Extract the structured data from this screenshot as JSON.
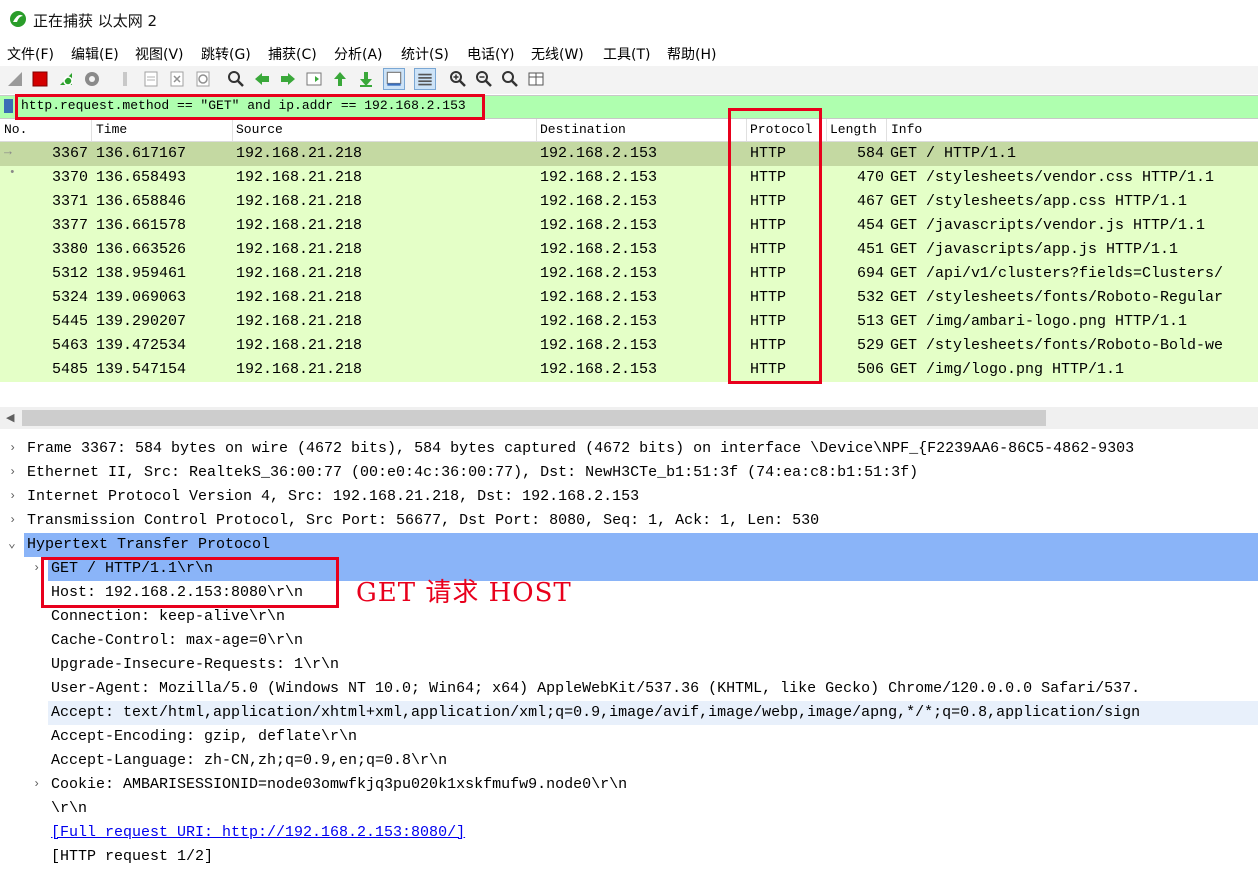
{
  "window": {
    "title": "正在捕获 以太网 2"
  },
  "menu": [
    "文件(F)",
    "编辑(E)",
    "视图(V)",
    "跳转(G)",
    "捕获(C)",
    "分析(A)",
    "统计(S)",
    "电话(Y)",
    "无线(W)",
    "工具(T)",
    "帮助(H)"
  ],
  "toolbar": {
    "icons": [
      "shark-fin-start-icon",
      "stop-capture-icon",
      "restart-capture-icon",
      "capture-options-icon",
      "open-file-icon",
      "save-file-icon",
      "close-file-icon",
      "reload-file-icon",
      "find-packet-icon",
      "go-back-icon",
      "go-forward-icon",
      "go-to-packet-icon",
      "first-packet-icon",
      "last-packet-icon",
      "auto-scroll-icon",
      "colorize-icon",
      "zoom-in-icon",
      "zoom-out-icon",
      "normal-size-icon",
      "resize-columns-icon"
    ]
  },
  "filter": {
    "expression": "http.request.method == \"GET\" and ip.addr == 192.168.2.153"
  },
  "packet_list": {
    "columns": [
      "No.",
      "Time",
      "Source",
      "Destination",
      "Protocol",
      "Length",
      "Info"
    ],
    "rows": [
      {
        "no": "3367",
        "time": "136.617167",
        "src": "192.168.21.218",
        "dst": "192.168.2.153",
        "proto": "HTTP",
        "len": "584",
        "info": "GET / HTTP/1.1"
      },
      {
        "no": "3370",
        "time": "136.658493",
        "src": "192.168.21.218",
        "dst": "192.168.2.153",
        "proto": "HTTP",
        "len": "470",
        "info": "GET /stylesheets/vendor.css HTTP/1.1"
      },
      {
        "no": "3371",
        "time": "136.658846",
        "src": "192.168.21.218",
        "dst": "192.168.2.153",
        "proto": "HTTP",
        "len": "467",
        "info": "GET /stylesheets/app.css HTTP/1.1"
      },
      {
        "no": "3377",
        "time": "136.661578",
        "src": "192.168.21.218",
        "dst": "192.168.2.153",
        "proto": "HTTP",
        "len": "454",
        "info": "GET /javascripts/vendor.js HTTP/1.1"
      },
      {
        "no": "3380",
        "time": "136.663526",
        "src": "192.168.21.218",
        "dst": "192.168.2.153",
        "proto": "HTTP",
        "len": "451",
        "info": "GET /javascripts/app.js HTTP/1.1"
      },
      {
        "no": "5312",
        "time": "138.959461",
        "src": "192.168.21.218",
        "dst": "192.168.2.153",
        "proto": "HTTP",
        "len": "694",
        "info": "GET /api/v1/clusters?fields=Clusters/"
      },
      {
        "no": "5324",
        "time": "139.069063",
        "src": "192.168.21.218",
        "dst": "192.168.2.153",
        "proto": "HTTP",
        "len": "532",
        "info": "GET /stylesheets/fonts/Roboto-Regular"
      },
      {
        "no": "5445",
        "time": "139.290207",
        "src": "192.168.21.218",
        "dst": "192.168.2.153",
        "proto": "HTTP",
        "len": "513",
        "info": "GET /img/ambari-logo.png HTTP/1.1"
      },
      {
        "no": "5463",
        "time": "139.472534",
        "src": "192.168.21.218",
        "dst": "192.168.2.153",
        "proto": "HTTP",
        "len": "529",
        "info": "GET /stylesheets/fonts/Roboto-Bold-we"
      },
      {
        "no": "5485",
        "time": "139.547154",
        "src": "192.168.21.218",
        "dst": "192.168.2.153",
        "proto": "HTTP",
        "len": "506",
        "info": "GET /img/logo.png HTTP/1.1"
      }
    ]
  },
  "details": [
    {
      "text": "Frame 3367: 584 bytes on wire (4672 bits), 584 bytes captured (4672 bits) on interface \\Device\\NPF_{F2239AA6-86C5-4862-9303",
      "expander": "›",
      "indent": 0
    },
    {
      "text": "Ethernet II, Src: RealtekS_36:00:77 (00:e0:4c:36:00:77), Dst: NewH3CTe_b1:51:3f (74:ea:c8:b1:51:3f)",
      "expander": "›",
      "indent": 0
    },
    {
      "text": "Internet Protocol Version 4, Src: 192.168.21.218, Dst: 192.168.2.153",
      "expander": "›",
      "indent": 0
    },
    {
      "text": "Transmission Control Protocol, Src Port: 56677, Dst Port: 8080, Seq: 1, Ack: 1, Len: 530",
      "expander": "›",
      "indent": 0
    },
    {
      "text": "Hypertext Transfer Protocol",
      "expander": "⌄",
      "indent": 0
    },
    {
      "text": "GET / HTTP/1.1\\r\\n",
      "expander": "›",
      "indent": 1
    },
    {
      "text": "Host: 192.168.2.153:8080\\r\\n",
      "expander": "",
      "indent": 1
    },
    {
      "text": "Connection: keep-alive\\r\\n",
      "expander": "",
      "indent": 1
    },
    {
      "text": "Cache-Control: max-age=0\\r\\n",
      "expander": "",
      "indent": 1
    },
    {
      "text": "Upgrade-Insecure-Requests: 1\\r\\n",
      "expander": "",
      "indent": 1
    },
    {
      "text": "User-Agent: Mozilla/5.0 (Windows NT 10.0; Win64; x64) AppleWebKit/537.36 (KHTML, like Gecko) Chrome/120.0.0.0 Safari/537.",
      "expander": "",
      "indent": 1
    },
    {
      "text": "Accept: text/html,application/xhtml+xml,application/xml;q=0.9,image/avif,image/webp,image/apng,*/*;q=0.8,application/sign",
      "expander": "",
      "indent": 1
    },
    {
      "text": "Accept-Encoding: gzip, deflate\\r\\n",
      "expander": "",
      "indent": 1
    },
    {
      "text": "Accept-Language: zh-CN,zh;q=0.9,en;q=0.8\\r\\n",
      "expander": "",
      "indent": 1
    },
    {
      "text": "Cookie: AMBARISESSIONID=node03omwfkjq3pu020k1xskfmufw9.node0\\r\\n",
      "expander": "›",
      "indent": 1
    },
    {
      "text": "\\r\\n",
      "expander": "",
      "indent": 1
    },
    {
      "text": "[Full request URI: http://192.168.2.153:8080/]",
      "expander": "",
      "indent": 1
    },
    {
      "text": "[HTTP request 1/2]",
      "expander": "",
      "indent": 1
    }
  ],
  "annotation": {
    "text": "GET 请求 HOST"
  },
  "colors": {
    "filter_bg": "#afffaf",
    "row_bg": "#e4ffc7",
    "row_selected": "#c4d9a2",
    "highlight": "#8ab4f8",
    "annotation": "#e8001c"
  }
}
